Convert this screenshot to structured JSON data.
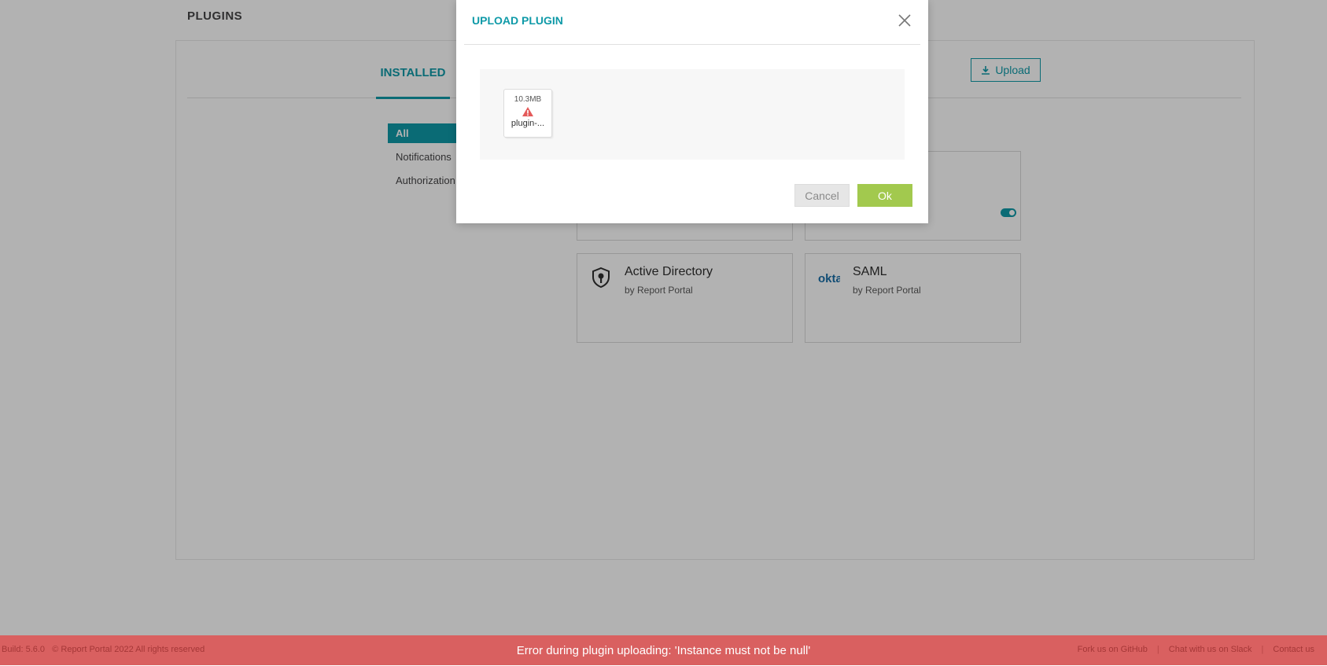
{
  "page": {
    "title": "PLUGINS"
  },
  "tabs": {
    "installed": "INSTALLED"
  },
  "toolbar": {
    "upload_label": "Upload"
  },
  "filters": {
    "all": "All",
    "notifications": "Notifications",
    "authorization": "Authorization"
  },
  "plugins": [
    {
      "name": "Active Directory",
      "author": "by Report Portal",
      "icon": "shield-key-icon"
    },
    {
      "name": "SAML",
      "author": "by Report Portal",
      "icon": "okta-logo-icon"
    }
  ],
  "modal": {
    "title": "UPLOAD PLUGIN",
    "file": {
      "size": "10.3MB",
      "name": "plugin-..."
    },
    "cancel_label": "Cancel",
    "ok_label": "Ok"
  },
  "toast": {
    "message": "Error during plugin uploading: 'Instance must not be null'"
  },
  "footer": {
    "build": "Build: 5.6.0",
    "copyright": "© Report Portal 2022 All rights reserved",
    "links": [
      "Fork us on GitHub",
      "Chat with us on Slack",
      "Contact us"
    ]
  },
  "colors": {
    "accent": "#0f9aa8",
    "ok": "#a2c94e",
    "error": "#d96060"
  }
}
